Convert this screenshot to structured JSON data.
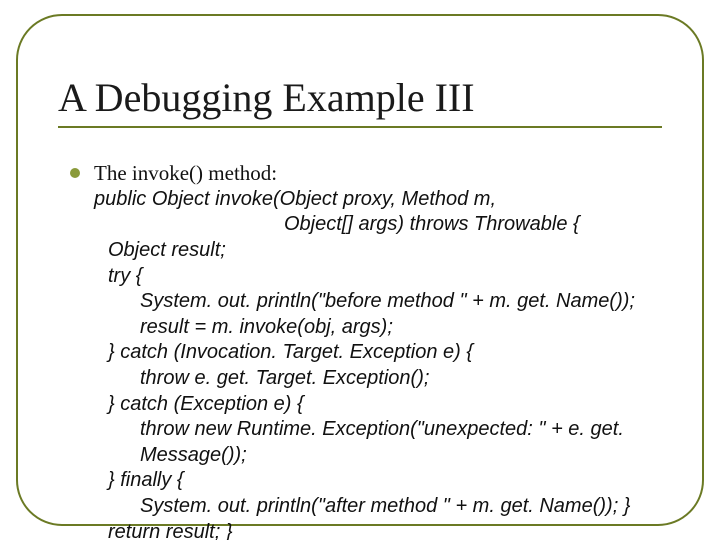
{
  "slide": {
    "title": "A Debugging Example III",
    "lead": "The invoke() method:",
    "code": {
      "sig_line1": "public Object invoke(Object proxy, Method m,",
      "sig_line2": "Object[] args) throws Throwable {",
      "decl": "Object result;",
      "try": "try {",
      "before_print": "System. out. println(\"before method \" + m. get. Name());",
      "invoke": "result = m. invoke(obj, args);",
      "catch1": "} catch (Invocation. Target. Exception e) {",
      "throw1": "throw e. get. Target. Exception();",
      "catch2": "} catch (Exception e) {",
      "throw2": "throw new Runtime. Exception(\"unexpected: \" + e. get. Message());",
      "finally": "} finally {",
      "after_print": "System. out. println(\"after method \" + m. get. Name()); }",
      "return": "return result; }"
    }
  }
}
